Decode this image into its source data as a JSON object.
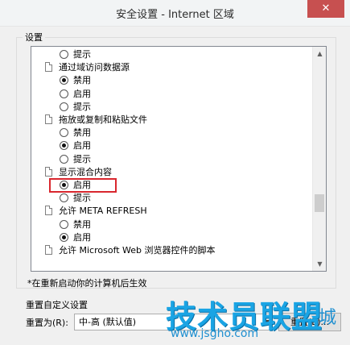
{
  "window": {
    "title": "安全设置 - Internet 区域",
    "close_glyph": "✕"
  },
  "settings_label": "设置",
  "tree": {
    "items": [
      {
        "kind": "radio",
        "label": "提示",
        "checked": false
      },
      {
        "kind": "setting",
        "label": "通过域访问数据源"
      },
      {
        "kind": "radio",
        "label": "禁用",
        "checked": true
      },
      {
        "kind": "radio",
        "label": "启用",
        "checked": false
      },
      {
        "kind": "radio",
        "label": "提示",
        "checked": false
      },
      {
        "kind": "setting",
        "label": "拖放或复制和粘贴文件"
      },
      {
        "kind": "radio",
        "label": "禁用",
        "checked": false
      },
      {
        "kind": "radio",
        "label": "启用",
        "checked": true
      },
      {
        "kind": "radio",
        "label": "提示",
        "checked": false
      },
      {
        "kind": "setting",
        "label": "显示混合内容"
      },
      {
        "kind": "radio",
        "label": "启用",
        "checked": true
      },
      {
        "kind": "radio",
        "label": "提示",
        "checked": false
      },
      {
        "kind": "setting",
        "label": "允许 META REFRESH"
      },
      {
        "kind": "radio",
        "label": "禁用",
        "checked": false
      },
      {
        "kind": "radio",
        "label": "启用",
        "checked": true
      },
      {
        "kind": "setting",
        "label": "允许 Microsoft Web 浏览器控件的脚本"
      }
    ],
    "highlighted_index": 10
  },
  "scrollbar": {
    "up_glyph": "▲",
    "down_glyph": "▼"
  },
  "restart_note": "*在重新启动你的计算机后生效",
  "reset": {
    "group_label": "重置自定义设置",
    "reset_to_label": "重置为(R):",
    "selected_value": "中-高 (默认值)",
    "dropdown_glyph": "▼",
    "button_label": "重置(E)..."
  },
  "watermark": {
    "main_text": "技术员联盟",
    "url": "www.jsgho.com",
    "side_text": "城"
  }
}
